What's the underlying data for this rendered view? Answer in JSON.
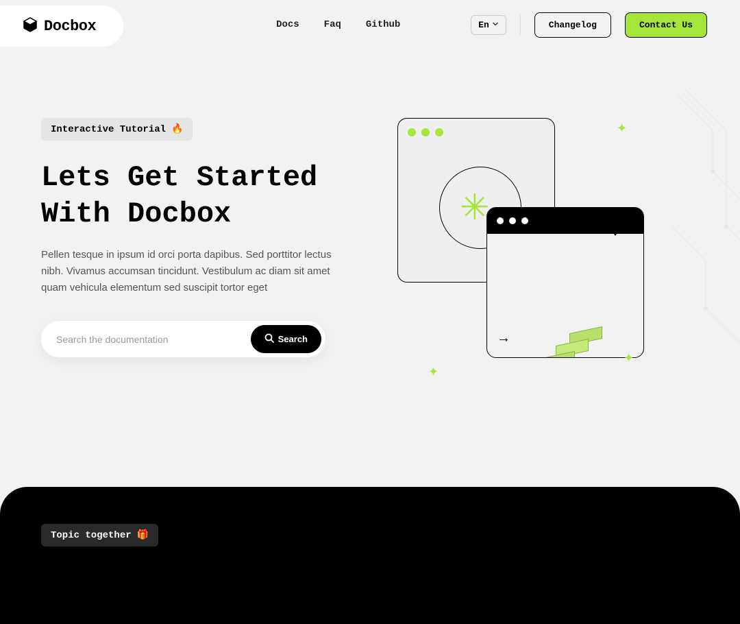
{
  "header": {
    "logo": "Docbox",
    "nav": {
      "docs": "Docs",
      "faq": "Faq",
      "github": "Github"
    },
    "lang": "En",
    "changelog": "Changelog",
    "contact": "Contact Us"
  },
  "hero": {
    "badge": "Interactive Tutorial",
    "badge_emoji": "🔥",
    "title": "Lets Get Started With Docbox",
    "desc": "Pellen tesque in ipsum id orci porta dapibus. Sed porttitor lectus nibh. Vivamus accumsan tincidunt. Vestibulum ac diam sit amet quam vehicula elementum sed suscipit tortor eget",
    "search_placeholder": "Search the documentation",
    "search_btn": "Search"
  },
  "dark": {
    "badge": "Topic together",
    "badge_emoji": "🎁"
  },
  "colors": {
    "accent": "#a6e53a",
    "bg": "#f2f2f2",
    "dark": "#000000"
  }
}
